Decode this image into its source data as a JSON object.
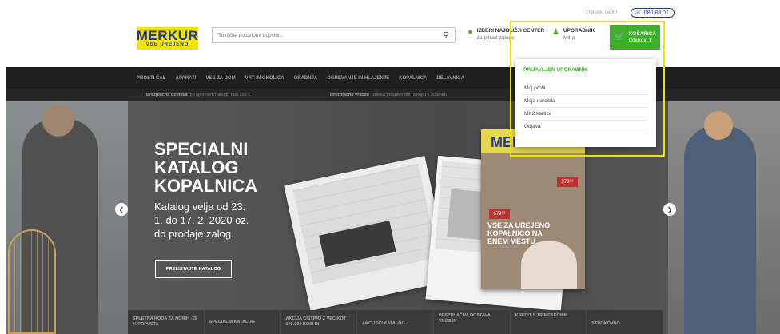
{
  "header": {
    "utility_link": "Trgovski centri",
    "phone": "080 88 01",
    "logo_line1": "MERKUR",
    "logo_line2": "VSE UREJENO",
    "search_placeholder": "Tu iščite po celotni trgovini...",
    "store_title": "IZBERI NAJBLIŽJI CENTER",
    "store_sub": "za prikaz zaloge",
    "user_title": "UPORABNIK",
    "user_name": "Miha",
    "cart_title": "KOŠARICA",
    "cart_count": "Izdelkov: 1"
  },
  "nav": {
    "items": [
      "PROSTI ČAS",
      "APARATI",
      "VSE ZA DOM",
      "VRT IN OKOLICA",
      "GRADNJA",
      "OGREVANJE IN HLAJENJE",
      "KOPALNICA",
      "DELAVNICA"
    ]
  },
  "promo": {
    "left_bold": "Brezplačna dostava",
    "left_rest": "pri spletnem nakupu nad 100 €",
    "right_bold": "Brezplačno vračilo",
    "right_rest": "izdelka pri spletnem nakupu v 30 dneh"
  },
  "hero": {
    "title_lines": [
      "SPECIALNI",
      "KATALOG",
      "KOPALNICA"
    ],
    "subtitle": "Katalog velja od 23. 1. do 17. 2. 2020 oz. do prodaje zalog.",
    "button": "PRELISTAJTE KATALOG",
    "cover_brand": "MER",
    "cover_price1": "379⁹⁹",
    "cover_price2": "679⁹⁹",
    "cover_text": "VSE ZA UREJENO KOPALNICO NA ENEM MESTU"
  },
  "bottom_tabs": [
    "SPLETNA KODA ZA NORIH -15 % POPUSTA",
    "SPECIALNI KATALOG",
    "AKCIJA ČISTIMO Z VEČ KOT 100.000 KOSI IN",
    "AKCIJSKI KATALOG",
    "BREZPLAČNA DOSTAVA, VNOS IN",
    "KREDIT S TRIMESEČNIM",
    "STROKOVNO"
  ],
  "user_dropdown": {
    "title": "PRIJAVLJEN UPORABNIK",
    "items": [
      "Moj profil",
      "Moja naročila",
      "MK2 kartica",
      "Odjava"
    ]
  },
  "colors": {
    "brand_green": "#3fae2a",
    "brand_yellow": "#f5e400",
    "brand_blue": "#1d3b8f",
    "highlight": "#ece500",
    "nav_bg": "#1f1f1f"
  },
  "icons": {
    "search": "search-icon",
    "pin": "location-pin-icon",
    "user": "user-icon",
    "cart": "cart-icon",
    "phone": "phone-icon",
    "prev": "chevron-left-icon",
    "next": "chevron-right-icon"
  }
}
